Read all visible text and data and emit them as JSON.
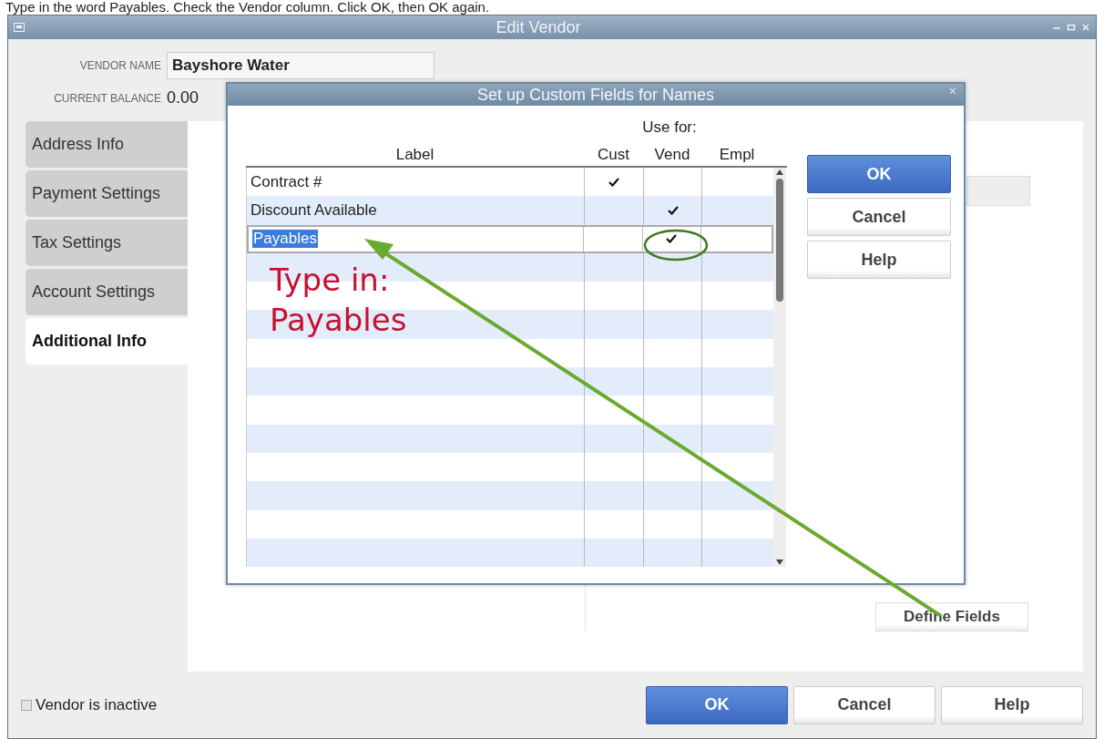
{
  "caption": "Type in the word Payables. Check the Vendor column. Click OK, then OK again.",
  "window": {
    "title": "Edit Vendor",
    "vendor_name_label": "VENDOR NAME",
    "vendor_name": "Bayshore Water",
    "current_balance_label": "CURRENT BALANCE",
    "current_balance": "0.00",
    "tabs": [
      {
        "label": "Address Info",
        "selected": false
      },
      {
        "label": "Payment Settings",
        "selected": false
      },
      {
        "label": "Tax Settings",
        "selected": false
      },
      {
        "label": "Account Settings",
        "selected": false
      },
      {
        "label": "Additional Info",
        "selected": true
      }
    ],
    "define_fields_button": "Define Fields",
    "vendor_inactive": {
      "label": "Vendor is inactive",
      "checked": false
    },
    "buttons": [
      {
        "label": "OK",
        "kind": "primary"
      },
      {
        "label": "Cancel",
        "kind": "normal"
      },
      {
        "label": "Help",
        "kind": "normal"
      }
    ]
  },
  "dialog": {
    "title": "Set up Custom Fields for Names",
    "close": "×",
    "use_for": "Use for:",
    "columns": [
      "Label",
      "Cust",
      "Vend",
      "Empl"
    ],
    "rows": [
      {
        "label": "Contract #",
        "cust": true,
        "vend": false,
        "empl": false,
        "selected": false
      },
      {
        "label": "Discount Available",
        "cust": false,
        "vend": true,
        "empl": false,
        "selected": false
      },
      {
        "label": "Payables",
        "cust": false,
        "vend": true,
        "empl": false,
        "selected": true
      }
    ],
    "buttons": [
      {
        "label": "OK",
        "kind": "primary"
      },
      {
        "label": "Cancel",
        "kind": "normal"
      },
      {
        "label": "Help",
        "kind": "normal"
      }
    ]
  },
  "annotation": {
    "lines": [
      "Type in:",
      "Payables"
    ]
  }
}
